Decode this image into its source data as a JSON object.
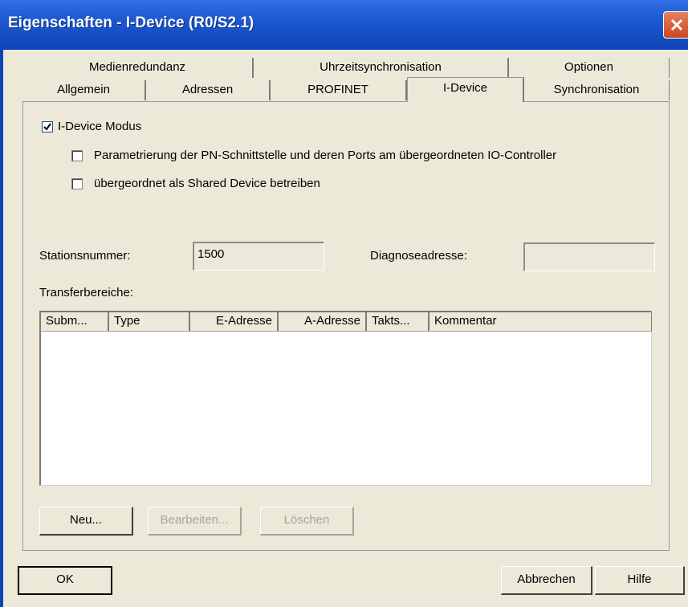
{
  "window": {
    "title": "Eigenschaften - I-Device (R0/S2.1)"
  },
  "tabs_row1": [
    "Medienredundanz",
    "Uhrzeitsynchronisation",
    "Optionen"
  ],
  "tabs_row2": [
    "Allgemein",
    "Adressen",
    "PROFINET",
    "I-Device",
    "Synchronisation"
  ],
  "options": {
    "idevice_mode": {
      "label": "I-Device Modus",
      "checked": true
    },
    "param_pn": {
      "label": "Parametrierung der PN-Schnittstelle und deren Ports am übergeordneten IO-Controller",
      "checked": false
    },
    "shared_device": {
      "label": "übergeordnet als Shared Device betreiben",
      "checked": false
    }
  },
  "fields": {
    "station_label": "Stationsnummer:",
    "station_value": "1500",
    "diag_label": "Diagnoseadresse:",
    "diag_value": ""
  },
  "transfer": {
    "label": "Transferbereiche:",
    "columns": [
      "Subm...",
      "Type",
      "E-Adresse",
      "A-Adresse",
      "Takts...",
      "Kommentar"
    ]
  },
  "buttons": {
    "new": "Neu...",
    "edit": "Bearbeiten...",
    "delete": "Löschen",
    "ok": "OK",
    "cancel": "Abbrechen",
    "help": "Hilfe"
  }
}
